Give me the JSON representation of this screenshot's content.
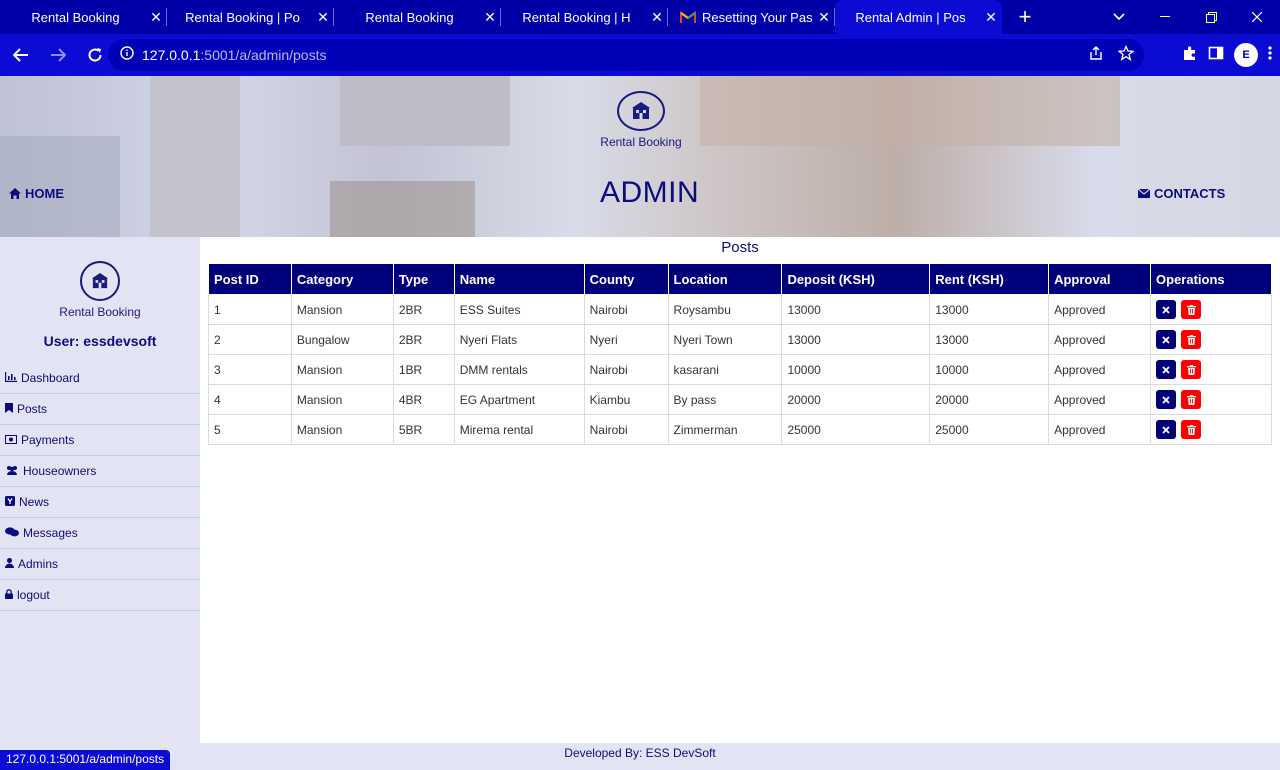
{
  "browser": {
    "tabs": [
      {
        "title": "Rental Booking",
        "active": false,
        "favicon": ""
      },
      {
        "title": "Rental Booking | Po",
        "active": false,
        "favicon": ""
      },
      {
        "title": "Rental Booking",
        "active": false,
        "favicon": ""
      },
      {
        "title": "Rental Booking | H",
        "active": false,
        "favicon": ""
      },
      {
        "title": "Resetting Your Pas",
        "active": false,
        "favicon": "gmail-icon"
      },
      {
        "title": "Rental Admin | Pos",
        "active": true,
        "favicon": ""
      }
    ],
    "url_host": "127.0.0.1",
    "url_rest": ":5001/a/admin/posts",
    "profile_initial": "E",
    "status_url": "127.0.0.1:5001/a/admin/posts"
  },
  "header": {
    "logo_text": "Rental Booking",
    "title": "ADMIN",
    "home_label": "HOME",
    "contacts_label": "CONTACTS"
  },
  "sidebar": {
    "logo_text": "Rental Booking",
    "user_label": "User: essdevsoft",
    "items": [
      {
        "label": "Dashboard",
        "icon": "bar-chart-icon"
      },
      {
        "label": "Posts",
        "icon": "bookmark-icon"
      },
      {
        "label": "Payments",
        "icon": "money-icon"
      },
      {
        "label": "Houseowners",
        "icon": "users-icon"
      },
      {
        "label": "News",
        "icon": "news-icon"
      },
      {
        "label": "Messages",
        "icon": "comments-icon"
      },
      {
        "label": "Admins",
        "icon": "user-icon"
      },
      {
        "label": "logout",
        "icon": "lock-icon"
      }
    ]
  },
  "posts": {
    "title": "Posts",
    "columns": [
      "Post ID",
      "Category",
      "Type",
      "Name",
      "County",
      "Location",
      "Deposit (KSH)",
      "Rent (KSH)",
      "Approval",
      "Operations"
    ],
    "rows": [
      [
        "1",
        "Mansion",
        "2BR",
        "ESS Suites",
        "Nairobi",
        "Roysambu",
        "13000",
        "13000",
        "Approved"
      ],
      [
        "2",
        "Bungalow",
        "2BR",
        "Nyeri Flats",
        "Nyeri",
        "Nyeri Town",
        "13000",
        "13000",
        "Approved"
      ],
      [
        "3",
        "Mansion",
        "1BR",
        "DMM rentals",
        "Nairobi",
        "kasarani",
        "10000",
        "10000",
        "Approved"
      ],
      [
        "4",
        "Mansion",
        "4BR",
        "EG Apartment",
        "Kiambu",
        "By pass",
        "20000",
        "20000",
        "Approved"
      ],
      [
        "5",
        "Mansion",
        "5BR",
        "Mirema rental",
        "Nairobi",
        "Zimmerman",
        "25000",
        "25000",
        "Approved"
      ]
    ]
  },
  "footer": {
    "text": "Developed By: ESS DevSoft"
  },
  "colors": {
    "accent": "#00007a",
    "browser": "#0b0bd4",
    "delete": "#ff0000"
  }
}
